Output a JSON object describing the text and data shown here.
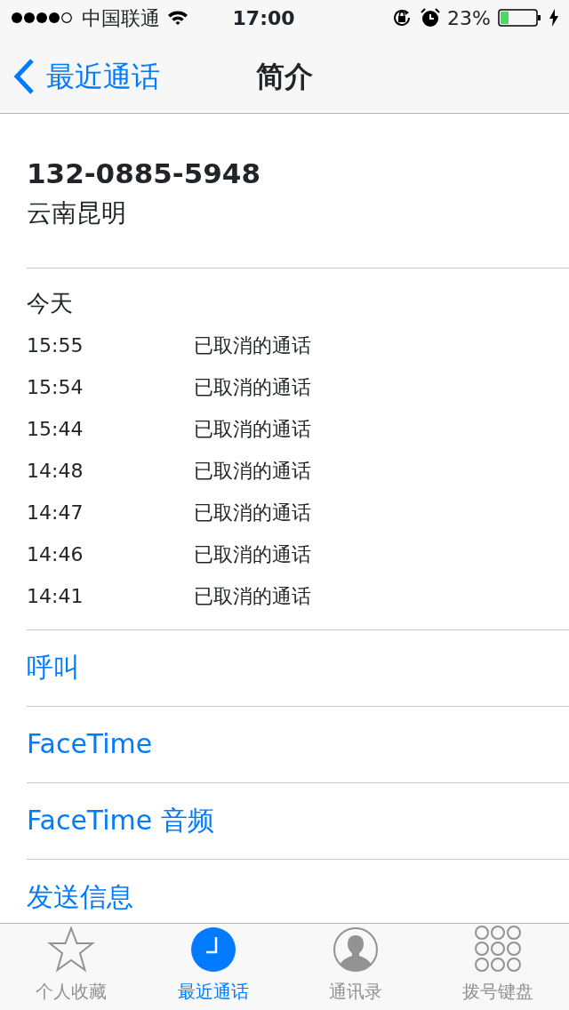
{
  "status_bar": {
    "carrier": "中国联通",
    "time": "17:00",
    "battery_text": "23%"
  },
  "nav": {
    "back_label": "最近通话",
    "title": "简介"
  },
  "contact": {
    "number": "132-0885-5948",
    "location": "云南昆明"
  },
  "calls": {
    "heading": "今天",
    "rows": [
      {
        "time": "15:55",
        "status": "已取消的通话"
      },
      {
        "time": "15:54",
        "status": "已取消的通话"
      },
      {
        "time": "15:44",
        "status": "已取消的通话"
      },
      {
        "time": "14:48",
        "status": "已取消的通话"
      },
      {
        "time": "14:47",
        "status": "已取消的通话"
      },
      {
        "time": "14:46",
        "status": "已取消的通话"
      },
      {
        "time": "14:41",
        "status": "已取消的通话"
      }
    ]
  },
  "actions": [
    {
      "label": "呼叫"
    },
    {
      "label": "FaceTime"
    },
    {
      "label": "FaceTime 音频"
    },
    {
      "label": "发送信息"
    }
  ],
  "tabs": [
    {
      "kind": "star",
      "label": "个人收藏",
      "selected": false
    },
    {
      "kind": "clock",
      "label": "最近通话",
      "selected": true
    },
    {
      "kind": "person",
      "label": "通讯录",
      "selected": false
    },
    {
      "kind": "keypad",
      "label": "拨号键盘",
      "selected": false
    }
  ]
}
